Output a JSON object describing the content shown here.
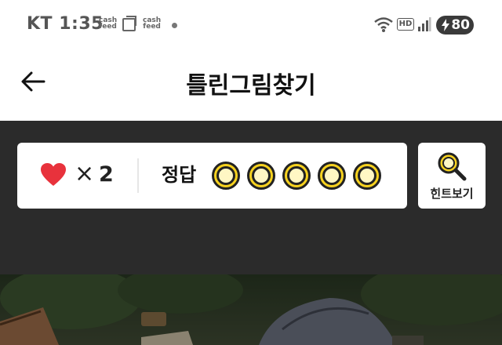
{
  "status_bar": {
    "carrier": "KT",
    "time": "1:35",
    "notif_app_1": "cash\nfeed",
    "notif_app_2": "cash\nfeed",
    "hd_label": "HD",
    "battery_level": "80"
  },
  "header": {
    "title": "틀린그림찾기"
  },
  "score": {
    "multiplier_symbol": "×",
    "lives": "2",
    "answer_label": "정답",
    "answer_slots": 5
  },
  "hint": {
    "label": "힌트보기"
  },
  "colors": {
    "heart": "#e8323c",
    "slot_fill": "#f7d21f",
    "game_bg": "#2b2b2b"
  },
  "icons": {
    "back": "arrow-left-icon",
    "heart": "heart-icon",
    "hint": "magnifier-icon"
  }
}
